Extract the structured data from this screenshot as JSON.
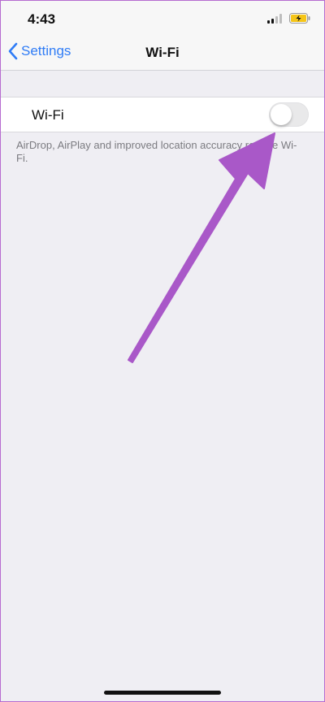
{
  "status_bar": {
    "time": "4:43",
    "signal_icon": "cellular-signal-icon",
    "battery_icon": "battery-charging-icon"
  },
  "nav": {
    "back_label": "Settings",
    "back_icon": "chevron-left-icon",
    "title": "Wi-Fi"
  },
  "wifi_row": {
    "label": "Wi-Fi",
    "enabled": false
  },
  "footer_text": "AirDrop, AirPlay and improved location accuracy require Wi-Fi.",
  "colors": {
    "accent": "#2f7cf6",
    "annotation_arrow": "#a958c8",
    "battery_fill": "#f5c518"
  }
}
